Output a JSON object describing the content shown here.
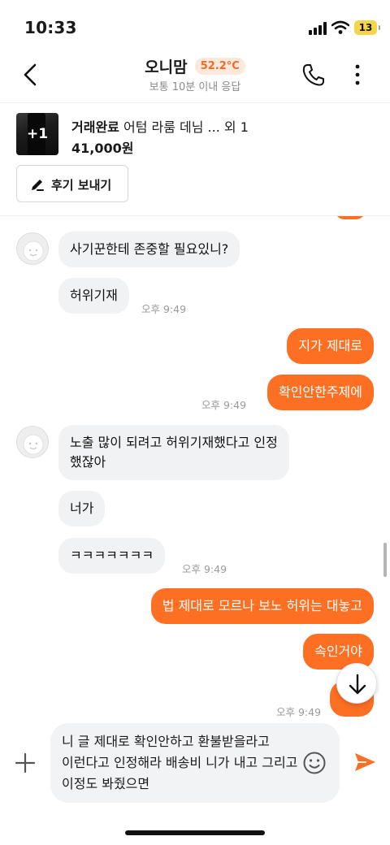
{
  "status_bar": {
    "time": "10:33",
    "battery": "13"
  },
  "header": {
    "name": "오니맘",
    "temperature": "52.2°C",
    "response_time": "보통 10분 이내 응답"
  },
  "product": {
    "thumb_count": "+1",
    "status": "거래완료",
    "title": "어텀 라룸 데님 ... 외 1",
    "price": "41,000원",
    "review_button": "후기 보내기"
  },
  "messages": [
    {
      "side": "in",
      "text": "사기꾼한테 존중할 필요있니?"
    },
    {
      "side": "in",
      "text": "허위기재",
      "time": "오후 9:49"
    },
    {
      "side": "out",
      "text": "지가 제대로"
    },
    {
      "side": "out",
      "text": "확인안한주제에",
      "time": "오후 9:49"
    },
    {
      "side": "in",
      "text": "노출 많이 되려고 허위기재했다고 인정\n했잖아"
    },
    {
      "side": "in",
      "text": "너가"
    },
    {
      "side": "in",
      "text": "ㅋㅋㅋㅋㅋㅋㅋ",
      "time": "오후 9:49"
    },
    {
      "side": "out",
      "text": "법 제대로 모르나 보노 허위는 대놓고"
    },
    {
      "side": "out",
      "text": "속인거야"
    },
    {
      "side": "out",
      "text": "",
      "time": "오후 9:49"
    }
  ],
  "input": {
    "value": "니 글 제대로 확인안하고 환불받을라고 이런다고 인정해라 배송비 니가 내고 그리고 이정도 봐줬으면"
  },
  "colors": {
    "accent": "#fd6f22",
    "incoming_bubble": "#f1f2f4",
    "temperature": "#f26a25"
  },
  "icons": [
    "back-arrow-icon",
    "phone-icon",
    "more-vertical-icon",
    "pencil-icon",
    "arrow-down-icon",
    "plus-icon",
    "smile-icon",
    "send-icon"
  ]
}
